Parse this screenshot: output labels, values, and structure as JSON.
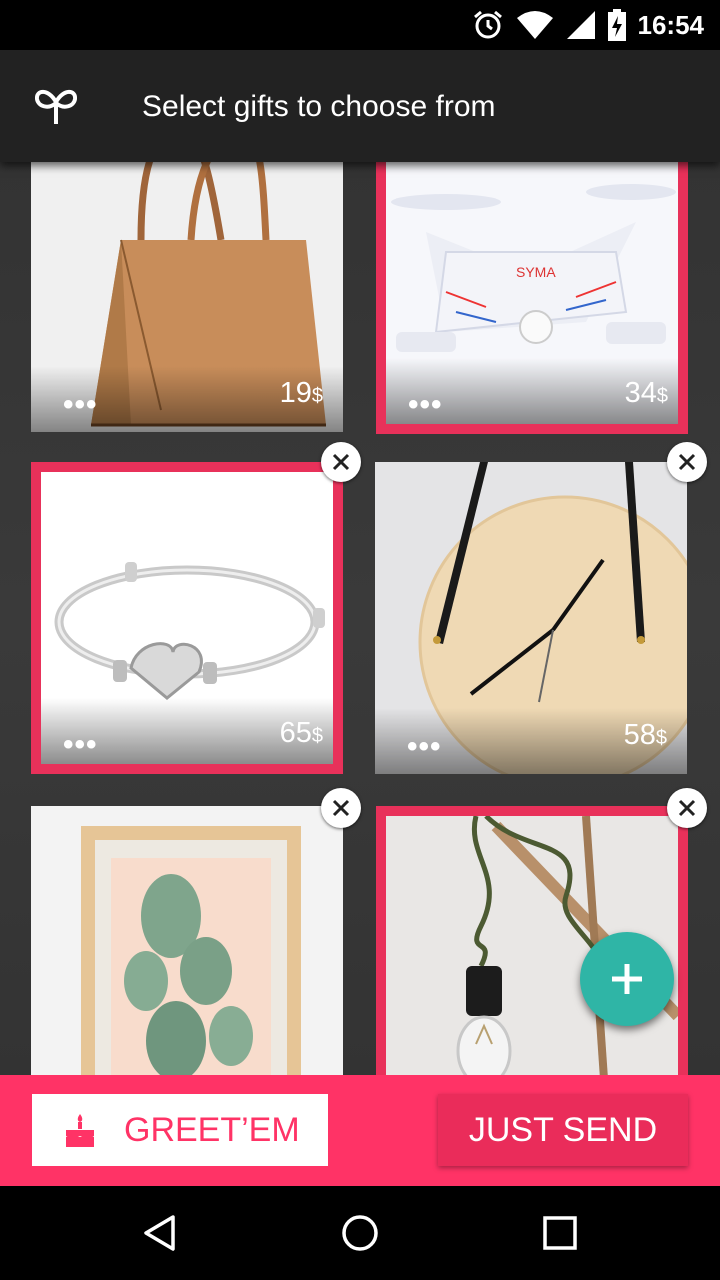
{
  "status_bar": {
    "time": "16:54",
    "icons": [
      "alarm-icon",
      "wifi-icon",
      "signal-icon",
      "battery-charging-icon"
    ]
  },
  "app_bar": {
    "logo_icon": "heart-gift-icon",
    "title": "Select gifts to choose from"
  },
  "gifts": [
    {
      "name": "tote-bag",
      "price": "19",
      "currency": "$",
      "selected": false,
      "removable": false
    },
    {
      "name": "drone",
      "price": "34",
      "currency": "$",
      "selected": true,
      "removable": false
    },
    {
      "name": "bracelet",
      "price": "65",
      "currency": "$",
      "selected": true,
      "removable": true
    },
    {
      "name": "wall-clock",
      "price": "58",
      "currency": "$",
      "selected": false,
      "removable": true
    },
    {
      "name": "cactus-print",
      "price": "",
      "currency": "",
      "selected": false,
      "removable": true
    },
    {
      "name": "pendant-lamp",
      "price": "",
      "currency": "",
      "selected": true,
      "removable": true
    }
  ],
  "more_label": "•••",
  "fab": {
    "icon": "plus-icon"
  },
  "actions": {
    "greet_label": "GREET’EM",
    "greet_icon": "cake-icon",
    "send_label": "JUST SEND"
  },
  "colors": {
    "accent": "#ff3366",
    "selected_border": "#e8315a",
    "fab": "#2fb5a6",
    "app_bar": "#222222"
  },
  "nav": {
    "icons": [
      "back-icon",
      "home-icon",
      "recents-icon"
    ]
  }
}
